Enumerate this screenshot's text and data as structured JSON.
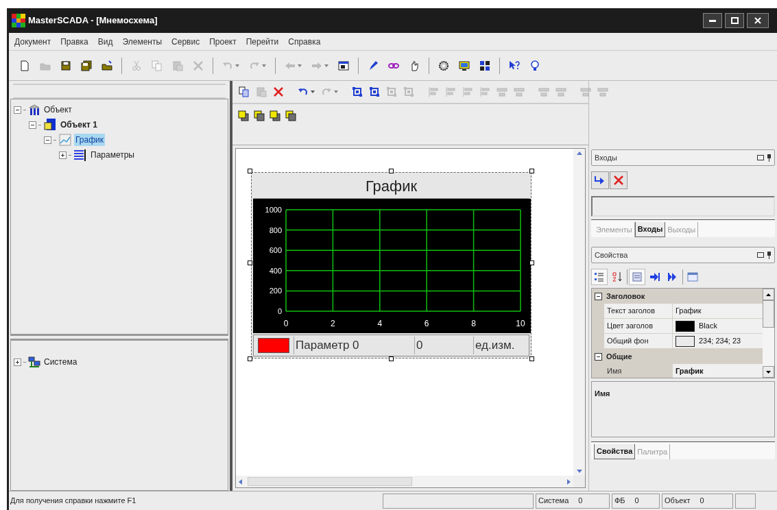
{
  "window": {
    "title": "MasterSCADA - [Мнемосхема]"
  },
  "menu": [
    "Документ",
    "Правка",
    "Вид",
    "Элементы",
    "Сервис",
    "Проект",
    "Перейти",
    "Справка"
  ],
  "main_toolbar": [
    {
      "enabled": true
    },
    {
      "enabled": false
    },
    {
      "enabled": true
    },
    {
      "enabled": true
    },
    {
      "enabled": true
    },
    {
      "enabled": false
    },
    {
      "enabled": false
    },
    {
      "enabled": false
    },
    {
      "enabled": false
    },
    {
      "enabled": false
    },
    {
      "enabled": false
    },
    {
      "enabled": false
    },
    {
      "enabled": false
    },
    {
      "enabled": true
    },
    {
      "enabled": true
    },
    {
      "enabled": true
    },
    {
      "enabled": true
    },
    {
      "enabled": true
    },
    {
      "enabled": true
    },
    {
      "enabled": true
    },
    {
      "enabled": true
    },
    {
      "enabled": true
    }
  ],
  "edit_toolbar": [
    {
      "enabled": true
    },
    {
      "enabled": false
    },
    {
      "enabled": true
    },
    {
      "enabled": true
    },
    {
      "enabled": false
    },
    {
      "enabled": true
    },
    {
      "enabled": true
    },
    {
      "enabled": false
    },
    {
      "enabled": false
    },
    {
      "enabled": false
    },
    {
      "enabled": false
    },
    {
      "enabled": false
    },
    {
      "enabled": false
    },
    {
      "enabled": false
    },
    {
      "enabled": false
    },
    {
      "enabled": false
    },
    {
      "enabled": false
    },
    {
      "enabled": false
    },
    {
      "enabled": false
    }
  ],
  "layer_toolbar": [
    {
      "enabled": true
    },
    {
      "enabled": true
    },
    {
      "enabled": true
    },
    {
      "enabled": true
    }
  ],
  "object_tree": [
    {
      "label": "Объект",
      "kind": "group",
      "bold": false,
      "selected": false,
      "expanded": true,
      "children": [
        {
          "label": "Объект 1",
          "kind": "object",
          "bold": true,
          "selected": false,
          "expanded": true,
          "children": [
            {
              "label": "График",
              "kind": "chart",
              "bold": false,
              "selected": true,
              "expanded": true,
              "children": [
                {
                  "label": "Параметры",
                  "kind": "params",
                  "bold": false,
                  "selected": false,
                  "expanded": false
                }
              ]
            }
          ]
        }
      ]
    }
  ],
  "system_tree": [
    {
      "label": "Система",
      "kind": "system",
      "bold": false,
      "selected": false,
      "expanded": false
    }
  ],
  "chart": {
    "legend": [
      {
        "name": "Параметр 0",
        "color": "#ff0000",
        "value": "0",
        "unit": "ед.изм."
      }
    ],
    "chart_data": {
      "type": "line",
      "grid": true,
      "title": "График",
      "xlim": [
        0,
        10
      ],
      "ylim": [
        0,
        1000
      ],
      "xticks": [
        0,
        2,
        4,
        6,
        8,
        10
      ],
      "yticks": [
        0,
        200,
        400,
        600,
        800,
        1000
      ]
    }
  },
  "inputs_panel": {
    "title": "Входы",
    "tabs": [
      {
        "label": "Элементы",
        "selected": false
      },
      {
        "label": "Входы",
        "selected": true
      },
      {
        "label": "Выходы",
        "selected": false
      }
    ]
  },
  "properties_panel": {
    "title": "Свойства",
    "toolbar": [
      {
        "pressed": true
      },
      {
        "pressed": false
      },
      {
        "pressed": true
      },
      {
        "pressed": false
      },
      {
        "pressed": false
      },
      {
        "pressed": false
      }
    ],
    "groups": [
      {
        "name": "Заголовок",
        "expanded": true,
        "rows": [
          {
            "name": "Текст заголов",
            "value": "График",
            "selected": false
          },
          {
            "name": "Цвет заголов",
            "value": "Black",
            "color": "#000000",
            "selected": false
          },
          {
            "name": "Общий фон",
            "value": "234; 234; 23",
            "color": "#eaeaea",
            "selected": false
          }
        ]
      },
      {
        "name": "Общие",
        "expanded": true,
        "rows": [
          {
            "name": "Имя",
            "value": "График",
            "selected": true
          }
        ]
      }
    ],
    "description": "Имя",
    "tabs": [
      {
        "label": "Свойства",
        "selected": true
      },
      {
        "label": "Палитра",
        "selected": false
      }
    ]
  },
  "status_bar": {
    "hint": "Для получения справки нажмите F1",
    "panes": [
      {
        "label": "Система",
        "value": "0"
      },
      {
        "label": "ФБ",
        "value": "0"
      },
      {
        "label": "Объект",
        "value": "0"
      }
    ]
  }
}
